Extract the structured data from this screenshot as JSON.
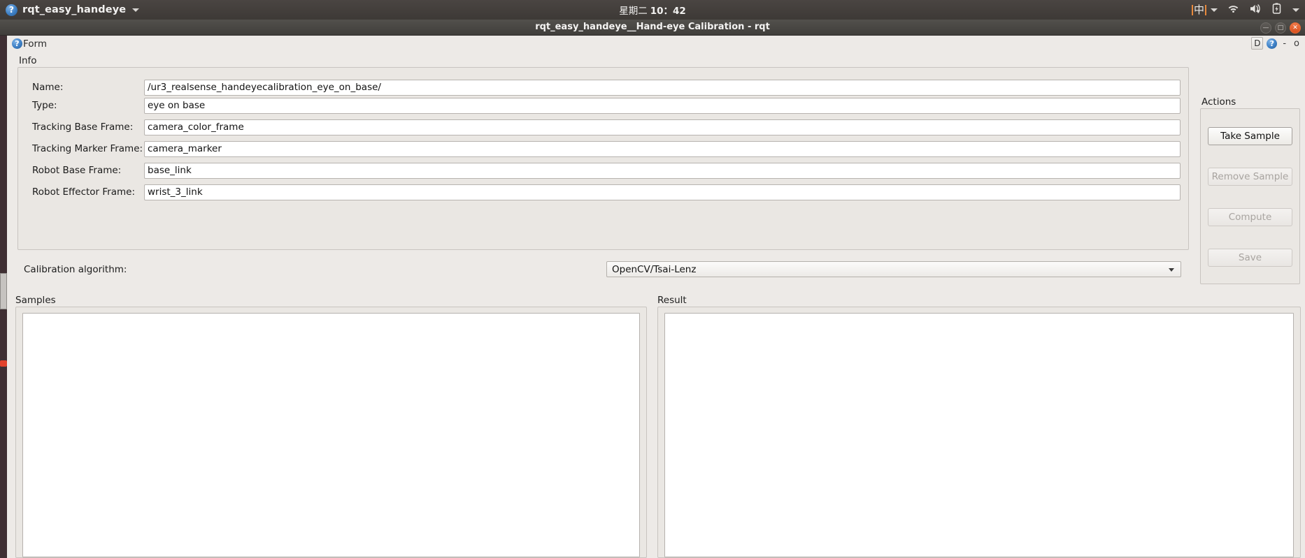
{
  "system_panel": {
    "app_menu_label": "rqt_easy_handeye",
    "help_glyph": "?",
    "clock": {
      "weekday": "星期二",
      "time": "10：42"
    },
    "tray": {
      "ime_label": "中",
      "wifi_icon": "wifi-icon",
      "volume_icon": "volume-muted-icon",
      "battery_icon": "battery-charging-icon"
    }
  },
  "window": {
    "title": "rqt_easy_handeye__Hand-eye Calibration - rqt",
    "minimize_label": "—",
    "maximize_label": "□",
    "close_label": "✕"
  },
  "form_bar": {
    "help_glyph": "?",
    "title": "Form",
    "dock_label": "D",
    "help_icon_label": "?",
    "minimize_glyph": "-",
    "float_glyph": "o"
  },
  "info": {
    "group_label": "Info",
    "fields": [
      {
        "label": "Name:",
        "value": "/ur3_realsense_handeyecalibration_eye_on_base/"
      },
      {
        "label": "Type:",
        "value": "eye on base"
      },
      {
        "label": "Tracking Base Frame:",
        "value": "camera_color_frame"
      },
      {
        "label": "Tracking Marker Frame:",
        "value": "camera_marker"
      },
      {
        "label": "Robot Base Frame:",
        "value": "base_link"
      },
      {
        "label": "Robot Effector Frame:",
        "value": "wrist_3_link"
      }
    ]
  },
  "algorithm": {
    "label": "Calibration algorithm:",
    "selected": "OpenCV/Tsai-Lenz"
  },
  "actions": {
    "group_label": "Actions",
    "buttons": [
      {
        "label": "Take Sample",
        "enabled": true
      },
      {
        "label": "Remove Sample",
        "enabled": false
      },
      {
        "label": "Compute",
        "enabled": false
      },
      {
        "label": "Save",
        "enabled": false
      }
    ]
  },
  "samples": {
    "label": "Samples",
    "items": []
  },
  "result": {
    "label": "Result",
    "items": []
  },
  "colors": {
    "panel_bg": "#3d3936",
    "form_bg": "#edeae7",
    "group_bg": "#eae7e3",
    "input_bg": "#ffffff",
    "close_accent": "#d94f1c",
    "ime_accent": "#e8893c",
    "launcher_bg": "#3f2f33"
  }
}
